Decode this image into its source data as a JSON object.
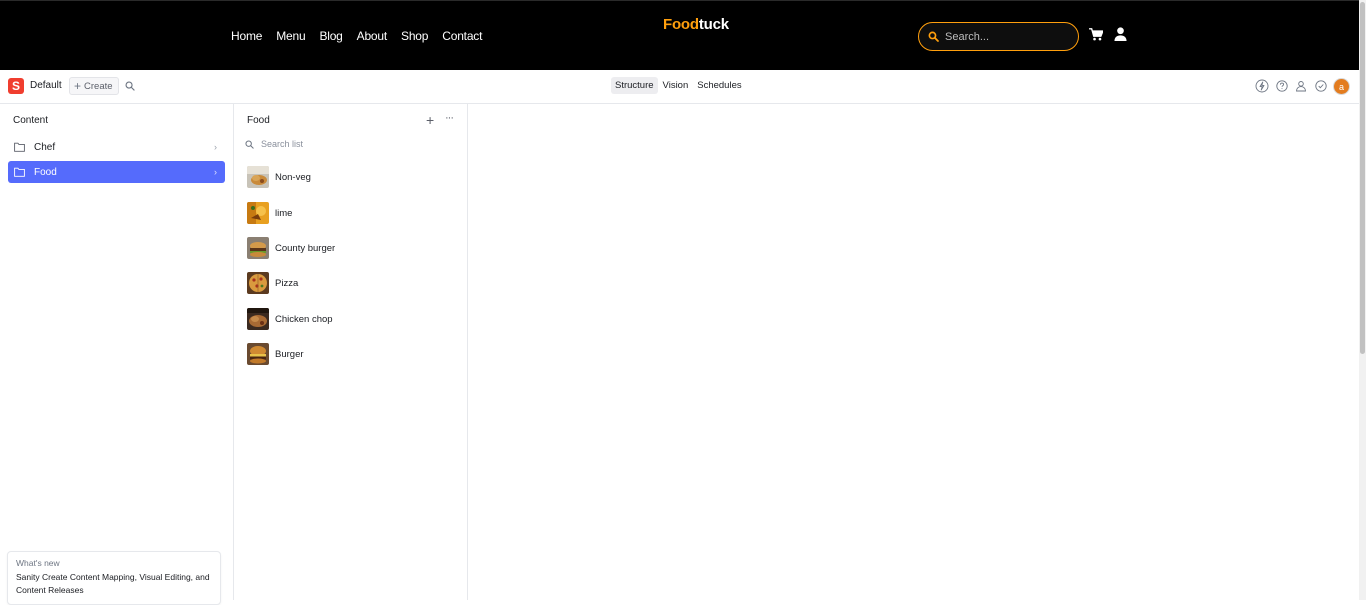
{
  "site": {
    "nav": [
      "Home",
      "Menu",
      "Blog",
      "About",
      "Shop",
      "Contact"
    ],
    "brand_part1": "Food",
    "brand_part2": "tuck",
    "search_placeholder": "Search...",
    "colors": {
      "accent": "#ff9f0d",
      "background": "#000000"
    }
  },
  "studio": {
    "workspace_initial": "S",
    "workspace_name": "Default",
    "create_label": "Create",
    "tools": [
      {
        "label": "Structure",
        "active": true
      },
      {
        "label": "Vision",
        "active": false
      },
      {
        "label": "Schedules",
        "active": false
      }
    ],
    "toolbar_icons": [
      "lightning-icon",
      "help-icon",
      "presence-icon",
      "tasks-icon"
    ],
    "avatar_initial": "a",
    "colors": {
      "selected": "#556bfc",
      "logo": "#f03e2f",
      "avatar": "#e37c1f"
    }
  },
  "content_pane": {
    "title": "Content",
    "items": [
      {
        "label": "Chef",
        "selected": false
      },
      {
        "label": "Food",
        "selected": true
      }
    ]
  },
  "list_pane": {
    "title": "Food",
    "search_placeholder": "Search list",
    "documents": [
      {
        "label": "Non-veg"
      },
      {
        "label": "lime"
      },
      {
        "label": "County burger"
      },
      {
        "label": "Pizza"
      },
      {
        "label": "Chicken chop"
      },
      {
        "label": "Burger"
      }
    ]
  },
  "whats_new": {
    "kicker": "What's new",
    "text": "Sanity Create Content Mapping, Visual Editing, and Content Releases"
  }
}
